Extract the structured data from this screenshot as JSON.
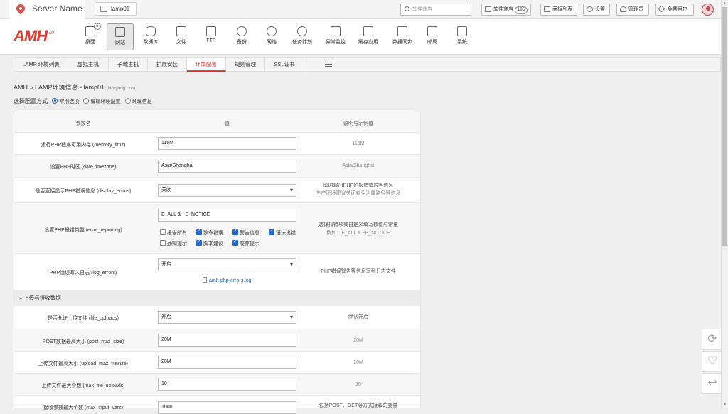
{
  "topbar": {
    "server_name": "Server Name",
    "lamp_tab": "lamp01",
    "search_placeholder": "软件商店",
    "buttons": [
      {
        "label": "软件商店",
        "count": "105"
      },
      {
        "label": "面板列表"
      },
      {
        "label": "设置"
      },
      {
        "label": "管理员"
      },
      {
        "label": "免费用户"
      }
    ]
  },
  "nav": {
    "logo": "AMH",
    "logo_version": "7.0",
    "items": [
      {
        "label": "桌面",
        "badge": "5"
      },
      {
        "label": "网站"
      },
      {
        "label": "数据库"
      },
      {
        "label": "文件"
      },
      {
        "label": "FTP"
      },
      {
        "label": "备份"
      },
      {
        "label": "网络"
      },
      {
        "label": "任务计划"
      },
      {
        "label": "异常监控"
      },
      {
        "label": "缓存应用"
      },
      {
        "label": "数据同步"
      },
      {
        "label": "邮局"
      },
      {
        "label": "系统"
      }
    ]
  },
  "subtabs": [
    "LAMP 环境列表",
    "虚拟主机",
    "子域主机",
    "扩展安装",
    "环境配置",
    "规则管理",
    "SSL证书"
  ],
  "breadcrumb": {
    "text": "AMH » LAMP环境信息 - lamp01",
    "domain": "(laoqiong.com)"
  },
  "mode": {
    "label": "选择配置方式",
    "options": [
      "常用选项",
      "编辑环境配置",
      "环境信息"
    ]
  },
  "table": {
    "headers": [
      "参数名",
      "值",
      "说明与示例值"
    ],
    "rows": {
      "memory_limit": {
        "name": "运行PHP程序可用内存 (memory_limit)",
        "value": "115M",
        "desc": "115M"
      },
      "timezone": {
        "name": "设置PHP时区 (date.timezone)",
        "value": "Asia/Shanghai",
        "desc": "Asia/Shanghai"
      },
      "display_errors": {
        "name": "是否直接显示PHP错误信息 (display_errors)",
        "value": "关闭",
        "desc1": "即时输出PHP的报错警告等信息",
        "desc2": "生产环境建议关闭避免泄露路径等信息"
      },
      "error_reporting": {
        "name": "设置PHP报错类型 (error_reporting)",
        "value": "E_ALL & ~E_NOTICE",
        "desc1": "选择报错项或自定义填写数值与常量",
        "desc2": "例如：E_ALL & ~E_NOTICE",
        "checks": [
          {
            "label": "报告所有",
            "checked": false
          },
          {
            "label": "致命错误",
            "checked": true
          },
          {
            "label": "警告信息",
            "checked": true
          },
          {
            "label": "语法出错",
            "checked": true
          },
          {
            "label": "通知提示",
            "checked": false
          },
          {
            "label": "脚本建议",
            "checked": true
          },
          {
            "label": "废弃提示",
            "checked": true
          }
        ]
      },
      "log_errors": {
        "name": "PHP错误写入日志 (log_errors)",
        "value": "开启",
        "desc": "PHP错误警告等信息写到日志文件",
        "file": "amh-php-errors.log"
      },
      "section_upload": "» 上传与接收数据",
      "file_uploads": {
        "name": "是否允许上传文件 (file_uploads)",
        "value": "开启",
        "desc": "默认开启"
      },
      "post_max_size": {
        "name": "POST数据最高大小 (post_max_size)",
        "value": "20M",
        "desc": "20M"
      },
      "upload_max_filesize": {
        "name": "上传文件最高大小 (upload_max_filesize)",
        "value": "20M",
        "desc": "20M"
      },
      "max_file_uploads": {
        "name": "上传文件最大个数 (max_file_uploads)",
        "value": "10",
        "desc": "10"
      },
      "max_input_vars": {
        "name": "接收参数最大个数 (max_input_vars)",
        "value": "1000",
        "desc": "包括POST、GET等方式接收的变量"
      }
    }
  }
}
